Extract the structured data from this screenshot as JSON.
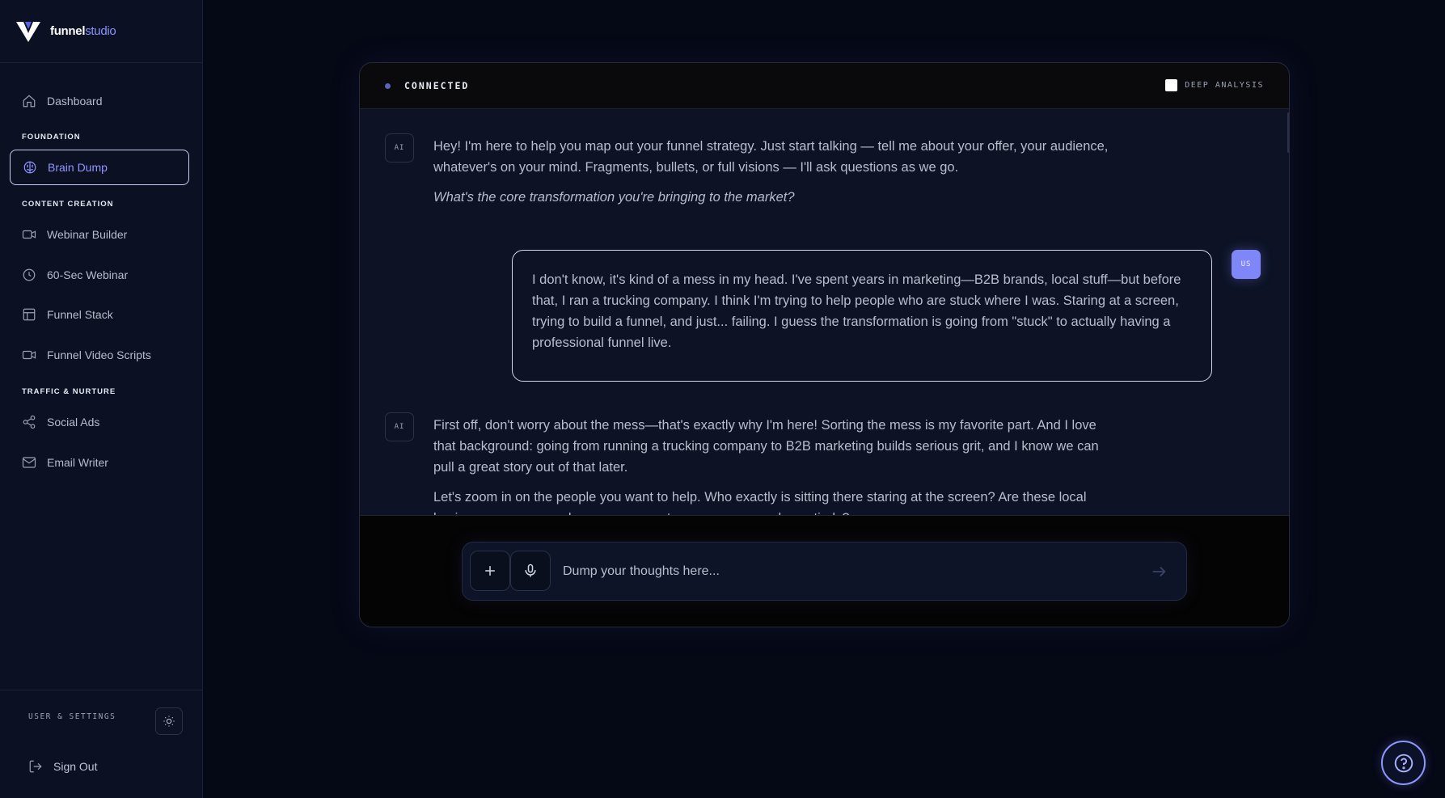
{
  "brand": {
    "name_bold": "funnel",
    "name_light": "studio"
  },
  "sidebar": {
    "dashboard": {
      "label": "Dashboard",
      "icon": "home-icon"
    },
    "sections": [
      {
        "label": "FOUNDATION",
        "items": [
          {
            "label": "Brain Dump",
            "icon": "brain-icon",
            "active": true
          }
        ]
      },
      {
        "label": "CONTENT CREATION",
        "items": [
          {
            "label": "Webinar Builder",
            "icon": "video-icon"
          },
          {
            "label": "60-Sec Webinar",
            "icon": "clock-icon"
          },
          {
            "label": "Funnel Stack",
            "icon": "layout-icon"
          },
          {
            "label": "Funnel Video Scripts",
            "icon": "video-icon"
          }
        ]
      },
      {
        "label": "TRAFFIC & NURTURE",
        "items": [
          {
            "label": "Social Ads",
            "icon": "share-icon"
          },
          {
            "label": "Email Writer",
            "icon": "mail-icon"
          }
        ]
      }
    ],
    "footer": {
      "settings_label": "USER & SETTINGS",
      "signout_label": "Sign Out"
    }
  },
  "chat": {
    "status": "CONNECTED",
    "deep_analysis_label": "DEEP ANALYSIS",
    "deep_analysis_checked": false,
    "ai_badge": "AI",
    "user_badge": "US",
    "messages": [
      {
        "role": "ai",
        "paragraphs": [
          "Hey! I'm here to help you map out your funnel strategy. Just start talking — tell me about your offer, your audience, whatever's on your mind. Fragments, bullets, or full visions — I'll ask questions as we go.",
          "What's the core transformation you're bringing to the market?"
        ]
      },
      {
        "role": "user",
        "text": "I don't know, it's kind of a mess in my head. I've spent years in marketing—B2B brands, local stuff—but before that, I ran a trucking company. I think I'm trying to help people who are stuck where I was. Staring at a screen, trying to build a funnel, and just... failing. I guess the transformation is going from \"stuck\" to actually having a professional funnel live."
      },
      {
        "role": "ai",
        "paragraphs": [
          "First off, don't worry about the mess—that's exactly why I'm here! Sorting the mess is my favorite part. And I love that background: going from running a trucking company to B2B marketing builds serious grit, and I know we can pull a great story out of that later.",
          "Let's zoom in on the people you want to help. Who exactly is sitting there staring at the screen? Are these local business owners, coaches, course creators, or someone else entirely?"
        ]
      }
    ],
    "input": {
      "placeholder": "Dump your thoughts here...",
      "value": ""
    }
  },
  "colors": {
    "accent": "#8f96ff",
    "background": "#050815",
    "sidebar": "#0b1122"
  }
}
